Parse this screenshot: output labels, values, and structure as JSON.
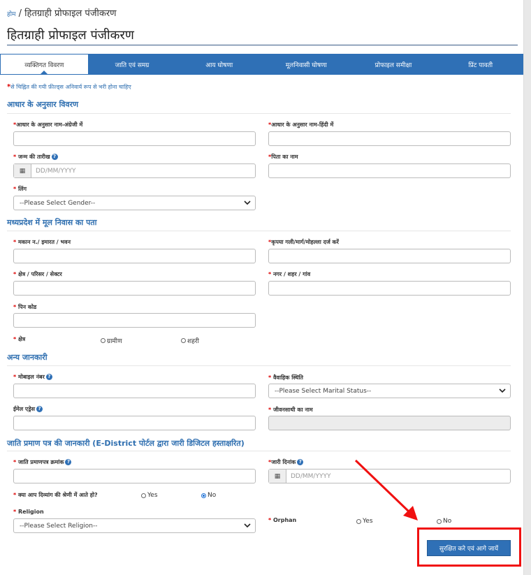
{
  "breadcrumb": {
    "home": "होम",
    "separator": "/",
    "current": "हितग्राही प्रोफाइल पंजीकरण"
  },
  "page_title": "हितग्राही प्रोफाइल पंजीकरण",
  "tabs": [
    {
      "label": "व्यक्तिगत विवरण",
      "active": true
    },
    {
      "label": "जाति एवं समग्र"
    },
    {
      "label": "आय घोषणा"
    },
    {
      "label": "मूलनिवासी घोषणा"
    },
    {
      "label": "प्रोफाइल समीक्षा"
    },
    {
      "label": "प्रिंट पावती"
    }
  ],
  "required_note": {
    "star": "*",
    "text": "से चिह्नित की गयी फ़ील्ड्स अनिवार्य रूप से भरी होना चाहिए"
  },
  "sections": {
    "aadhaar": "आधार के अनुसार विवरण",
    "address": "मध्यप्रदेश में मूल निवास का पता",
    "other": "अन्य जानकारी",
    "caste_cert": "जाति प्रमाण पत्र की जानकारी (E-District पोर्टल द्वारा जारी डिजिटल हस्ताक्षरित)"
  },
  "fields": {
    "name_en": "आधार के अनुसार नाम-अंग्रेजी में",
    "name_hi": "आधार के अनुसार नाम-हिंदी में",
    "dob": " जन्म की तारीख",
    "dob_placeholder": "DD/MM/YYYY",
    "father": "पिता का नाम",
    "gender": " लिंग",
    "gender_placeholder": "--Please Select Gender--",
    "house": " मकान न./ इमारत / भवन",
    "street": "कृपया गली/मार्ग/मोहल्ला दर्ज करें",
    "area": " क्षेत्र / परिसर / सेक्टर",
    "city": " नगर / शहर / गांव",
    "pincode": " पिन कोड",
    "region": " क्षेत्र",
    "region_rural": "ग्रामीण",
    "region_urban": "शहरी",
    "mobile": " मोबाइल नंबर",
    "marital": " वैवाहिक स्थिति",
    "marital_placeholder": "--Please Select Marital Status--",
    "email": "ईमेल एड्रेस",
    "spouse": " जीवनसाथी का नाम",
    "cert_no": " जाति प्रमाणपत्र क्रमांक",
    "issue_date": "जारी दिनांक",
    "issue_placeholder": "DD/MM/YYYY",
    "divyang": " क्या आप दिव्यांग की श्रेणी में आते हो?",
    "yes": "Yes",
    "no": "No",
    "religion": " Religion",
    "religion_placeholder": "--Please Select Religion--",
    "orphan": " Orphan"
  },
  "submit_label": "सुरक्षित करे एवं आगे जायें",
  "colors": {
    "primary": "#2f70b6",
    "required": "#dd0000",
    "highlight": "#f01010"
  },
  "icons": {
    "help": "question-circle-icon",
    "calendar": "calendar-icon",
    "dropdown": "chevron-down-icon"
  }
}
